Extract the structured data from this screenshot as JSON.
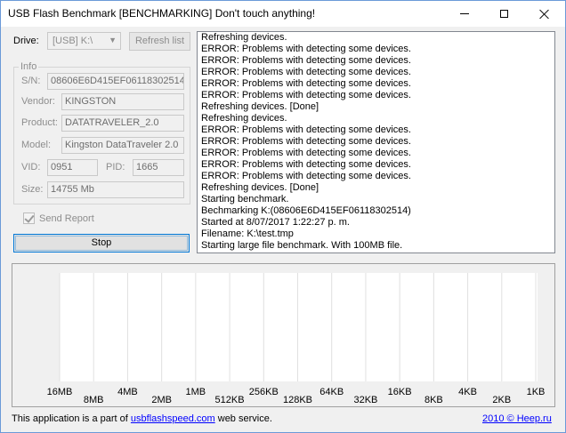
{
  "window": {
    "title": "USB Flash Benchmark [BENCHMARKING] Don't touch anything!"
  },
  "drive": {
    "label": "Drive:",
    "selected": "[USB] K:\\",
    "refresh_button": "Refresh list"
  },
  "info": {
    "legend": "Info",
    "sn_label": "S/N:",
    "sn_value": "08606E6D415EF06118302514",
    "vendor_label": "Vendor:",
    "vendor_value": "KINGSTON",
    "product_label": "Product:",
    "product_value": "DATATRAVELER_2.0",
    "model_label": "Model:",
    "model_value": "Kingston DataTraveler 2.0",
    "vid_label": "VID:",
    "vid_value": "0951",
    "pid_label": "PID:",
    "pid_value": "1665",
    "size_label": "Size:",
    "size_value": "14755 Mb"
  },
  "send_report": {
    "label": "Send Report",
    "checked": true
  },
  "stop_button": "Stop",
  "log_lines": [
    "Refreshing devices.",
    "ERROR: Problems with detecting some devices.",
    "ERROR: Problems with detecting some devices.",
    "ERROR: Problems with detecting some devices.",
    "ERROR: Problems with detecting some devices.",
    "ERROR: Problems with detecting some devices.",
    "Refreshing devices. [Done]",
    "Refreshing devices.",
    "ERROR: Problems with detecting some devices.",
    "ERROR: Problems with detecting some devices.",
    "ERROR: Problems with detecting some devices.",
    "ERROR: Problems with detecting some devices.",
    "ERROR: Problems with detecting some devices.",
    "Refreshing devices. [Done]",
    "Starting benchmark.",
    "Bechmarking K:(08606E6D415EF06118302514)",
    "Started at 8/07/2017 1:22:27 p. m.",
    "Filename: K:\\test.tmp",
    "Starting large file benchmark. With 100MB file."
  ],
  "chart": {
    "x_labels": [
      "16MB",
      "8MB",
      "4MB",
      "2MB",
      "1MB",
      "512KB",
      "256KB",
      "128KB",
      "64KB",
      "32KB",
      "16KB",
      "8KB",
      "4KB",
      "2KB",
      "1KB"
    ],
    "plot_background": "#ffffff",
    "grid_color": "#e0e0e0"
  },
  "footer": {
    "prefix": "This application is a part of ",
    "link": "usbflashspeed.com",
    "suffix": " web service.",
    "copyright": "2010 © Heep.ru"
  }
}
